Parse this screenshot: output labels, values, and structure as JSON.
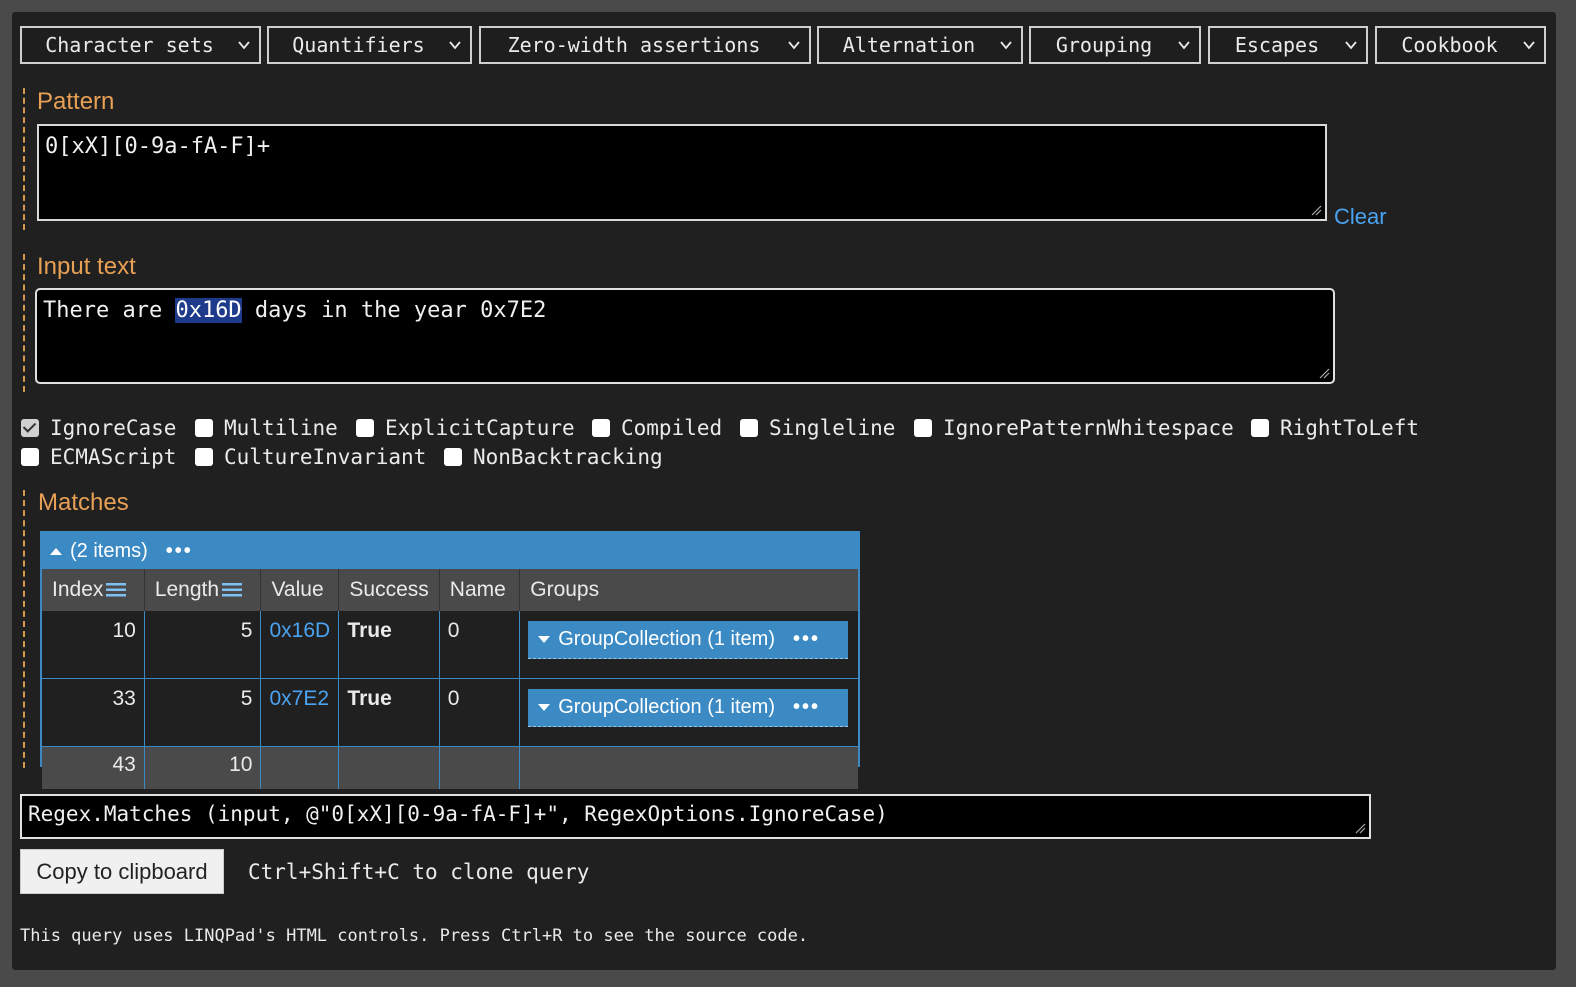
{
  "toolbar": {
    "menus": [
      {
        "label": "Character sets"
      },
      {
        "label": "Quantifiers"
      },
      {
        "label": "Zero-width assertions"
      },
      {
        "label": "Alternation"
      },
      {
        "label": "Grouping"
      },
      {
        "label": "Escapes"
      },
      {
        "label": "Cookbook"
      }
    ]
  },
  "pattern": {
    "heading": "Pattern",
    "value": "0[xX][0-9a-fA-F]+",
    "clear_label": "Clear"
  },
  "input": {
    "heading": "Input text",
    "before": "There are ",
    "highlight": "0x16D",
    "after": " days in the year 0x7E2"
  },
  "options": [
    {
      "label": "IgnoreCase",
      "checked": true
    },
    {
      "label": "Multiline",
      "checked": false
    },
    {
      "label": "ExplicitCapture",
      "checked": false
    },
    {
      "label": "Compiled",
      "checked": false
    },
    {
      "label": "Singleline",
      "checked": false
    },
    {
      "label": "IgnorePatternWhitespace",
      "checked": false
    },
    {
      "label": "RightToLeft",
      "checked": false
    },
    {
      "label": "ECMAScript",
      "checked": false
    },
    {
      "label": "CultureInvariant",
      "checked": false
    },
    {
      "label": "NonBacktracking",
      "checked": false
    }
  ],
  "matches": {
    "heading": "Matches",
    "summary": "(2 items)",
    "more": "•••",
    "columns": [
      "Index",
      "Length",
      "Value",
      "Success",
      "Name",
      "Groups"
    ],
    "rows": [
      {
        "index": "10",
        "length": "5",
        "value": "0x16D",
        "success": "True",
        "name": "0",
        "groups": "GroupCollection (1 item)"
      },
      {
        "index": "33",
        "length": "5",
        "value": "0x7E2",
        "success": "True",
        "name": "0",
        "groups": "GroupCollection (1 item)"
      }
    ],
    "totals": {
      "index": "43",
      "length": "10"
    }
  },
  "code": {
    "value": "Regex.Matches (input, @\"0[xX][0-9a-fA-F]+\", RegexOptions.IgnoreCase)"
  },
  "copy": {
    "button": "Copy to clipboard",
    "hint": "Ctrl+Shift+C to clone query"
  },
  "footer": {
    "text": "This query uses LINQPad's HTML controls. Press Ctrl+R to see the source code."
  }
}
